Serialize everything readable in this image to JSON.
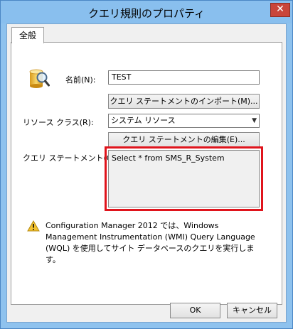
{
  "window": {
    "title": "クエリ規則のプロパティ",
    "close_glyph": "✕"
  },
  "tabs": [
    {
      "label": "全般"
    }
  ],
  "form": {
    "name_label": "名前(N):",
    "name_value": "TEST",
    "import_button": "クエリ ステートメントのインポート(M)...",
    "resource_class_label": "リソース クラス(R):",
    "resource_class_value": "システム リソース",
    "edit_button": "クエリ ステートメントの編集(E)...",
    "query_label": "クエリ ステートメント(Q):",
    "query_value": "Select * from SMS_R_System"
  },
  "info": {
    "text": "Configuration Manager 2012 では、Windows Management Instrumentation (WMI) Query Language (WQL) を使用してサイト データベースのクエリを実行します。"
  },
  "footer": {
    "ok_button": "OK",
    "cancel_button": "キャンセル"
  },
  "colors": {
    "highlight": "#e0141c",
    "titlebar": "#89bfee",
    "warning": "#f2c230"
  }
}
